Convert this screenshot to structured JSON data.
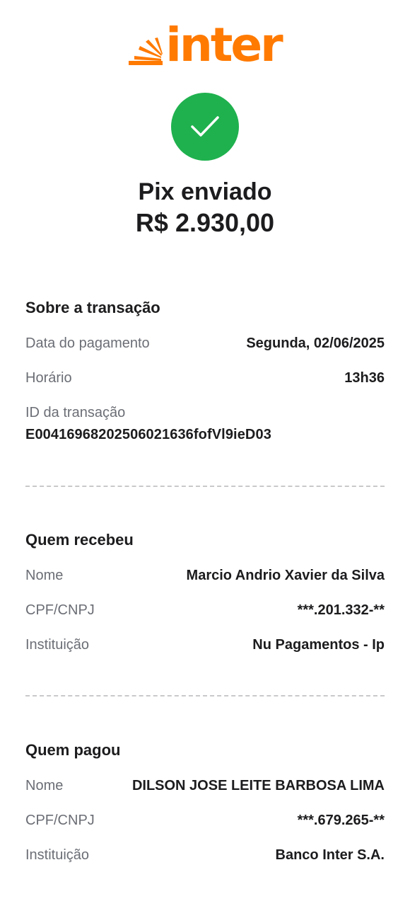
{
  "brand": {
    "name": "inter",
    "color": "#ff7a00"
  },
  "status": {
    "icon": "check-icon",
    "color": "#1fb14e",
    "title": "Pix enviado",
    "amount": "R$ 2.930,00"
  },
  "transaction": {
    "heading": "Sobre a transação",
    "date_label": "Data do pagamento",
    "date_value": "Segunda, 02/06/2025",
    "time_label": "Horário",
    "time_value": "13h36",
    "id_label": "ID da transação",
    "id_value": "E00416968202506021636fofVl9ieD03"
  },
  "receiver": {
    "heading": "Quem recebeu",
    "name_label": "Nome",
    "name_value": "Marcio Andrio Xavier da Silva",
    "doc_label": "CPF/CNPJ",
    "doc_value": "***.201.332-**",
    "bank_label": "Instituição",
    "bank_value": "Nu Pagamentos - Ip"
  },
  "payer": {
    "heading": "Quem pagou",
    "name_label": "Nome",
    "name_value": "DILSON JOSE LEITE BARBOSA LIMA",
    "doc_label": "CPF/CNPJ",
    "doc_value": "***.679.265-**",
    "bank_label": "Instituição",
    "bank_value": "Banco Inter S.A."
  }
}
